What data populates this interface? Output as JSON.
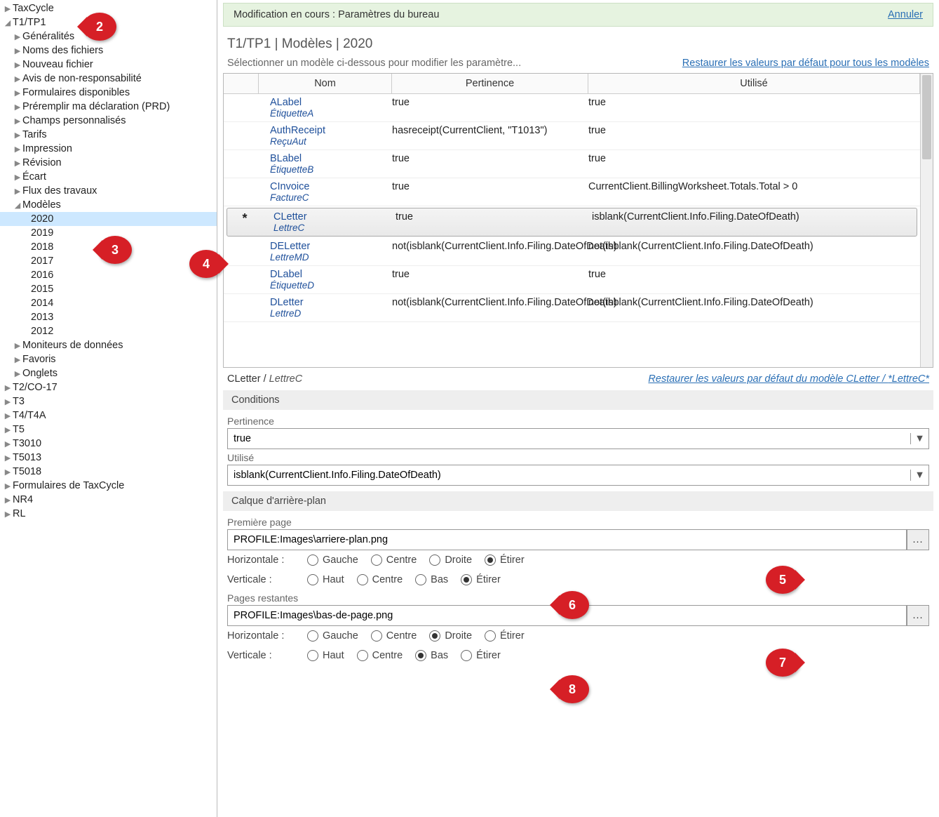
{
  "banner": {
    "text": "Modification en cours : Paramètres du bureau",
    "cancel": "Annuler"
  },
  "breadcrumb": "T1/TP1 | Modèles | 2020",
  "sub_text": "Sélectionner un modèle ci-dessous pour modifier les paramètre...",
  "sub_link": "Restaurer les valeurs par défaut pour tous les modèles",
  "columns": {
    "name": "Nom",
    "pert": "Pertinence",
    "used": "Utilisé"
  },
  "rows": [
    {
      "name": "ALabel",
      "sub": "ÉtiquetteA",
      "pert": "true",
      "used": "true"
    },
    {
      "name": "AuthReceipt",
      "sub": "ReçuAut",
      "pert": "hasreceipt(CurrentClient, \"T1013\")",
      "used": "true"
    },
    {
      "name": "BLabel",
      "sub": "ÉtiquetteB",
      "pert": "true",
      "used": "true"
    },
    {
      "name": "CInvoice",
      "sub": "FactureC",
      "pert": "true",
      "used": "CurrentClient.BillingWorksheet.Totals.Total > 0"
    },
    {
      "name": "CLetter",
      "sub": "LettreC",
      "pert": "true",
      "used": "isblank(CurrentClient.Info.Filing.DateOfDeath)",
      "selected": true,
      "mark": "*"
    },
    {
      "name": "DELetter",
      "sub": "LettreMD",
      "pert": "not(isblank(CurrentClient.Info.Filing.DateOfDeath)",
      "used": "not(isblank(CurrentClient.Info.Filing.DateOfDeath)"
    },
    {
      "name": "DLabel",
      "sub": "ÉtiquetteD",
      "pert": "true",
      "used": "true"
    },
    {
      "name": "DLetter",
      "sub": "LettreD",
      "pert": "not(isblank(CurrentClient.Info.Filing.DateOfDeath)",
      "used": "not(isblank(CurrentClient.Info.Filing.DateOfDeath)"
    }
  ],
  "detail": {
    "name": "CLetter",
    "sub": "LettreC",
    "restore_link_prefix": "Restaurer les valeurs par défaut du modèle CLetter / ",
    "restore_link_italic": "*LettreC*"
  },
  "sections": {
    "conditions": "Conditions",
    "pertinence_label": "Pertinence",
    "pertinence_value": "true",
    "utilise_label": "Utilisé",
    "utilise_value": "isblank(CurrentClient.Info.Filing.DateOfDeath)",
    "background": "Calque d'arrière-plan",
    "first_page_label": "Première page",
    "first_page_value": "PROFILE:Images\\arriere-plan.png",
    "remaining_label": "Pages restantes",
    "remaining_value": "PROFILE:Images\\bas-de-page.png",
    "horizontale": "Horizontale :",
    "verticale": "Verticale :",
    "gauche": "Gauche",
    "centre": "Centre",
    "droite": "Droite",
    "haut": "Haut",
    "bas": "Bas",
    "etirer": "Étirer"
  },
  "tree": {
    "taxcycle": "TaxCycle",
    "t1tp1": "T1/TP1",
    "generalites": "Généralités",
    "noms": "Noms des fichiers",
    "nouveau": "Nouveau fichier",
    "avis": "Avis de non-responsabilité",
    "formulaires": "Formulaires disponibles",
    "preremplir": "Préremplir ma déclaration (PRD)",
    "champs": "Champs personnalisés",
    "tarifs": "Tarifs",
    "impression": "Impression",
    "revision": "Révision",
    "ecart": "Écart",
    "flux": "Flux des travaux",
    "modeles": "Modèles",
    "years": [
      "2020",
      "2019",
      "2018",
      "2017",
      "2016",
      "2015",
      "2014",
      "2013",
      "2012"
    ],
    "moniteurs": "Moniteurs de données",
    "favoris": "Favoris",
    "onglets": "Onglets",
    "t2": "T2/CO-17",
    "t3": "T3",
    "t4": "T4/T4A",
    "t5": "T5",
    "t3010": "T3010",
    "t5013": "T5013",
    "t5018": "T5018",
    "formtax": "Formulaires de TaxCycle",
    "nr4": "NR4",
    "rl": "RL"
  },
  "callouts": {
    "2": "2",
    "3": "3",
    "4": "4",
    "5": "5",
    "6": "6",
    "7": "7",
    "8": "8"
  }
}
